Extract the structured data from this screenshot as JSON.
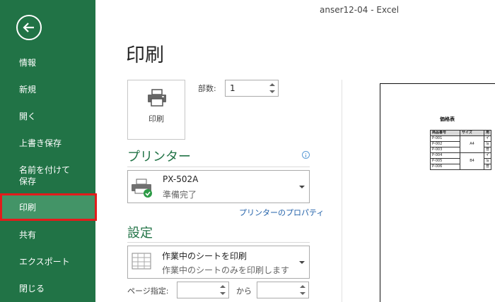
{
  "window": {
    "title": "anser12-04 - Excel"
  },
  "sidebar": {
    "items": [
      {
        "label": "情報"
      },
      {
        "label": "新規"
      },
      {
        "label": "開く"
      },
      {
        "label": "上書き保存"
      },
      {
        "label": "名前を付けて\n保存"
      },
      {
        "label": "印刷",
        "selected": true
      },
      {
        "label": "共有"
      },
      {
        "label": "エクスポート"
      },
      {
        "label": "閉じる"
      }
    ]
  },
  "print": {
    "page_title": "印刷",
    "button_label": "印刷",
    "copies_label": "部数:",
    "copies_value": "1"
  },
  "printer": {
    "section_title": "プリンター",
    "name": "PX-502A",
    "status": "準備完了",
    "properties_link": "プリンターのプロパティ"
  },
  "settings": {
    "section_title": "設定",
    "scope_main": "作業中のシートを印刷",
    "scope_sub": "作業中のシートのみを印刷します",
    "pages_label": "ページ指定:",
    "to_label": "から"
  },
  "preview": {
    "sheet_title": "価格表",
    "headers": [
      "商品番号",
      "サイズ",
      "用"
    ],
    "rows": [
      [
        "P-001",
        "",
        "イ"
      ],
      [
        "P-002",
        "A4",
        "写"
      ],
      [
        "P-003",
        "",
        "普"
      ],
      [
        "P-004",
        "",
        "イ"
      ],
      [
        "P-005",
        "B4",
        "写"
      ],
      [
        "P-006",
        "",
        "普"
      ]
    ]
  },
  "colors": {
    "brand": "#217346",
    "selected_nav": "#439467",
    "highlight": "#e31b1b",
    "link": "#1f5fa8"
  }
}
